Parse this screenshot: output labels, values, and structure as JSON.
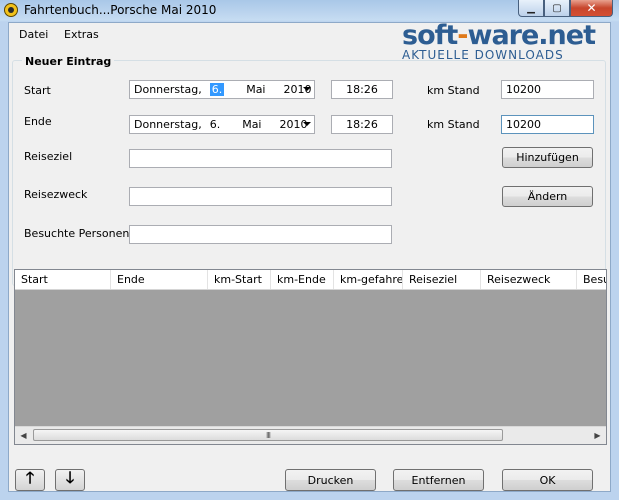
{
  "window": {
    "title": "Fahrtenbuch...Porsche Mai 2010"
  },
  "menu": [
    "Datei",
    "Extras"
  ],
  "watermark": {
    "brand_left": "soft",
    "brand_dash": "-",
    "brand_right": "ware.net",
    "tagline": "AKTUELLE DOWNLOADS"
  },
  "form": {
    "group_title": "Neuer Eintrag",
    "start": {
      "label": "Start",
      "weekday": "Donnerstag,",
      "day": "6.",
      "month": "Mai",
      "year": "2010",
      "time": "18:26"
    },
    "ende": {
      "label": "Ende",
      "weekday": "Donnerstag,",
      "day": "6.",
      "month": "Mai",
      "year": "2010",
      "time": "18:26"
    },
    "km_stand_label": "km Stand",
    "km_stand_start": "10200",
    "km_stand_ende": "10200",
    "reiseziel_label": "Reiseziel",
    "reisezweck_label": "Reisezweck",
    "personen_label": "Besuchte Personen",
    "btn_add": "Hinzufügen",
    "btn_edit": "Ändern"
  },
  "table": {
    "columns": [
      "Start",
      "Ende",
      "km-Start",
      "km-Ende",
      "km-gefahren",
      "Reiseziel",
      "Reisezweck",
      "Besu"
    ],
    "thumb_grip": "III"
  },
  "footer": {
    "btn_up": "🡑",
    "btn_down": "🡓",
    "btn_print": "Drucken",
    "btn_remove": "Entfernen",
    "btn_ok": "OK"
  }
}
